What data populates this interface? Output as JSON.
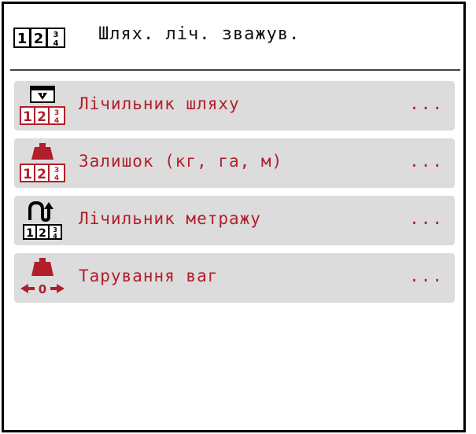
{
  "header": {
    "icon": "counter-icon",
    "title": "Шлях. ліч. зважув."
  },
  "menu": {
    "items": [
      {
        "icon": "trip-counter-icon",
        "label": "Лічильник шляху",
        "more": "..."
      },
      {
        "icon": "remaining-weight-icon",
        "label": "Залишок (кг, га, м)",
        "more": "..."
      },
      {
        "icon": "meter-counter-icon",
        "label": "Лічильник метражу",
        "more": "..."
      },
      {
        "icon": "tare-scale-icon",
        "label": "Тарування ваг",
        "more": "..."
      }
    ]
  },
  "colors": {
    "accent": "#b21e2a",
    "item_background": "#dcdcdc",
    "text_dark": "#111111"
  }
}
